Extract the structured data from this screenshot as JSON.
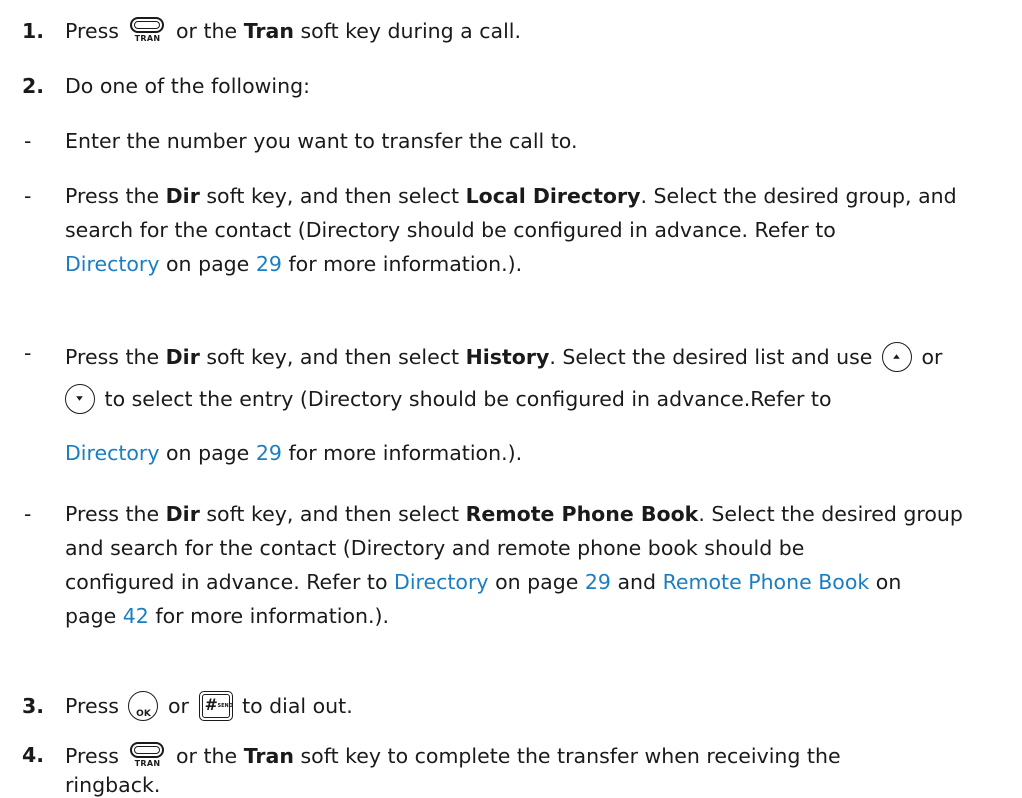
{
  "step1": {
    "marker": "1.",
    "press": "Press",
    "icon_label": "TRAN",
    "mid": "or the",
    "tran": "Tran",
    "end": "soft key during a call."
  },
  "step2": {
    "marker": "2.",
    "text": "Do one of the following:"
  },
  "option1": {
    "marker": "-",
    "text": "Enter the number you want to transfer the call to."
  },
  "option2": {
    "marker": "-",
    "a": "Press the",
    "dir": "Dir",
    "b": "soft key, and then select",
    "target": "Local Directory",
    "c": ". Select the desired group, and",
    "line2": "search for the contact (Directory should be configured in advance. Refer to",
    "link1": "Directory",
    "d": "on page",
    "page1": "29",
    "e": "for more information.)."
  },
  "option3": {
    "marker": "-",
    "a": "Press the",
    "dir": "Dir",
    "b": "soft key, and then select",
    "target": "History",
    "c": ". Select the desired list and use",
    "or": "or",
    "d": "to select the entry (Directory should be configured in advance.Refer to",
    "link1": "Directory",
    "e": "on page",
    "page1": "29",
    "f": "for more information.)."
  },
  "option4": {
    "marker": "-",
    "a": "Press the",
    "dir": "Dir",
    "b": "soft key, and then select",
    "target": "Remote Phone Book",
    "c": ". Select the desired group",
    "line2": "and search for the contact (Directory and remote phone book should be",
    "line3a": "configured in advance. Refer to",
    "link1": "Directory",
    "d": "on page",
    "page1": "29",
    "e": "and",
    "link2": "Remote Phone Book",
    "f": "on",
    "line4a": "page",
    "page2": "42",
    "g": "for more information.)."
  },
  "step3": {
    "marker": "3.",
    "press": "Press",
    "ok_label": "OK",
    "or": "or",
    "send_hash": "#",
    "send_label": "SEND",
    "end": "to dial out."
  },
  "step4": {
    "marker": "4.",
    "press": "Press",
    "icon_label": "TRAN",
    "mid": "or the",
    "tran": "Tran",
    "end": "soft key to complete the transfer when receiving the",
    "line2": "ringback."
  }
}
